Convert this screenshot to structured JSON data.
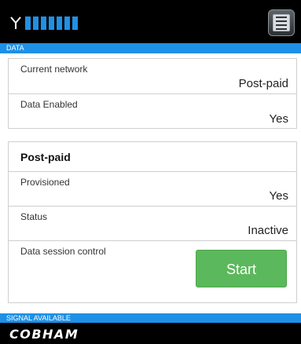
{
  "header": {
    "signal_icon": "antenna-icon",
    "signal_bars_total": 7,
    "signal_bars_active": 7,
    "menu_icon": "menu-icon",
    "accent_color": "#1e90e6"
  },
  "section": {
    "title": "DATA"
  },
  "network_card": {
    "rows": [
      {
        "label": "Current network",
        "value": "Post-paid"
      },
      {
        "label": "Data Enabled",
        "value": "Yes"
      }
    ]
  },
  "postpaid_card": {
    "title": "Post-paid",
    "rows": [
      {
        "label": "Provisioned",
        "value": "Yes"
      },
      {
        "label": "Status",
        "value": "Inactive"
      },
      {
        "label": "Data session control",
        "button_label": "Start",
        "button_color": "#5cb85c"
      }
    ]
  },
  "status": {
    "text": "SIGNAL AVAILABLE"
  },
  "footer": {
    "logo_text": "COBHAM"
  }
}
